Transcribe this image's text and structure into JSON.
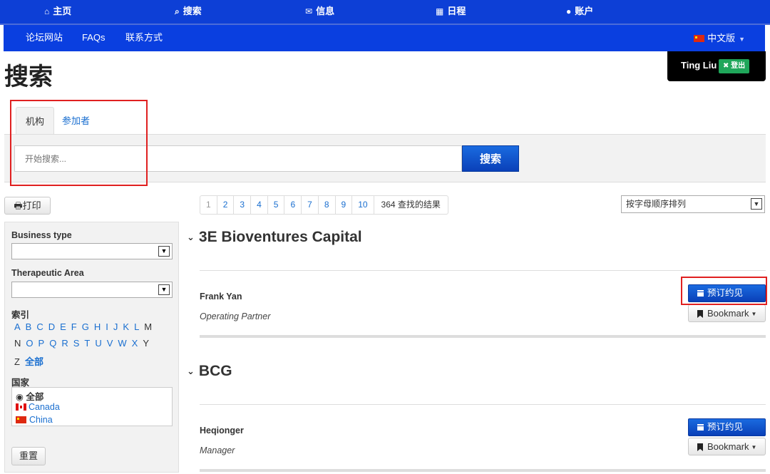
{
  "topnav": {
    "home": "主页",
    "search": "搜索",
    "messages": "信息",
    "schedule": "日程",
    "account": "账户"
  },
  "subnav": {
    "forum": "论坛网站",
    "faqs": "FAQs",
    "contact": "联系方式",
    "language": "中文版"
  },
  "page": {
    "title": "搜索"
  },
  "user": {
    "name": "Ting Liu",
    "logout": "登出"
  },
  "search": {
    "tabs": [
      "机构",
      "参加者"
    ],
    "placeholder": "开始搜索...",
    "button": "搜索"
  },
  "print_label": "打印",
  "filters": {
    "business_type_label": "Business type",
    "therapeutic_area_label": "Therapeutic Area",
    "index_label": "索引",
    "letters_row1": [
      "A",
      "B",
      "C",
      "D",
      "E",
      "F",
      "G",
      "H",
      "I",
      "J",
      "K",
      "L",
      "M"
    ],
    "letters_row2": [
      "N",
      "O",
      "P",
      "Q",
      "R",
      "S",
      "T",
      "U",
      "V",
      "W",
      "X",
      "Y"
    ],
    "letters_row3": [
      "Z"
    ],
    "all_label": "全部",
    "country_label": "国家",
    "countries": [
      "全部",
      "Canada",
      "China"
    ],
    "reset": "重置"
  },
  "pagination": {
    "pages": [
      "1",
      "2",
      "3",
      "4",
      "5",
      "6",
      "7",
      "8",
      "9",
      "10"
    ],
    "total": "364 查找的结果"
  },
  "sort": {
    "selected": "按字母顺序排列"
  },
  "results": [
    {
      "org": "3E Bioventures Capital",
      "person": "Frank Yan",
      "role": "Operating Partner",
      "book_label": "预订约见",
      "bookmark_label": "Bookmark"
    },
    {
      "org": "BCG",
      "person": "Heqionger",
      "role": "Manager",
      "book_label": "预订约见",
      "bookmark_label": "Bookmark"
    }
  ],
  "colors": {
    "nav": "#0d3fd6",
    "accent": "#0a48c8",
    "link": "#1a6fd0",
    "highlight": "#e02020",
    "logout": "#1fa65a"
  }
}
